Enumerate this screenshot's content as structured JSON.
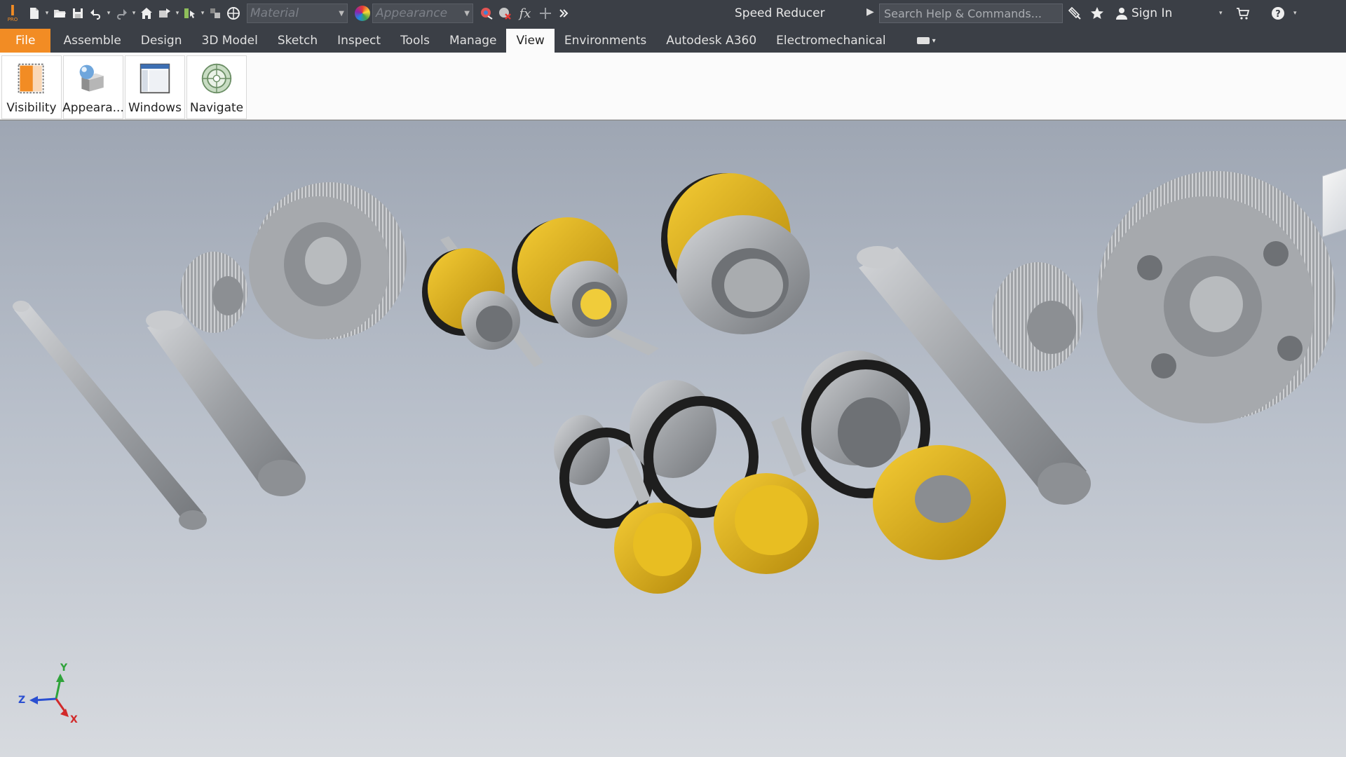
{
  "app": {
    "logo_text": "I",
    "logo_sub": "PRO"
  },
  "document": {
    "title": "Speed Reducer"
  },
  "qat": {
    "material": {
      "value": "Material"
    },
    "appearance": {
      "value": "Appearance"
    },
    "fx_label": "fx"
  },
  "search": {
    "placeholder": "Search Help & Commands..."
  },
  "account": {
    "sign_in": "Sign In"
  },
  "tabs": [
    {
      "label": "File"
    },
    {
      "label": "Assemble"
    },
    {
      "label": "Design"
    },
    {
      "label": "3D Model"
    },
    {
      "label": "Sketch"
    },
    {
      "label": "Inspect"
    },
    {
      "label": "Tools"
    },
    {
      "label": "Manage"
    },
    {
      "label": "View"
    },
    {
      "label": "Environments"
    },
    {
      "label": "Autodesk A360"
    },
    {
      "label": "Electromechanical"
    }
  ],
  "ribbon": [
    {
      "label": "Visibility",
      "icon": "visibility-icon"
    },
    {
      "label": "Appeara...",
      "icon": "appearance-icon"
    },
    {
      "label": "Windows",
      "icon": "windows-icon"
    },
    {
      "label": "Navigate",
      "icon": "navigate-icon"
    }
  ],
  "triad": {
    "x": "X",
    "y": "Y",
    "z": "Z"
  },
  "colors": {
    "title_bar": "#3b3f46",
    "file_tab": "#f28c24",
    "ribbon_bg": "#fbfbfb",
    "bronze_part": "#e2b316",
    "steel_part": "#a7aaae",
    "viewport_top": "#9ea6b3",
    "viewport_bottom": "#d7dadf"
  }
}
